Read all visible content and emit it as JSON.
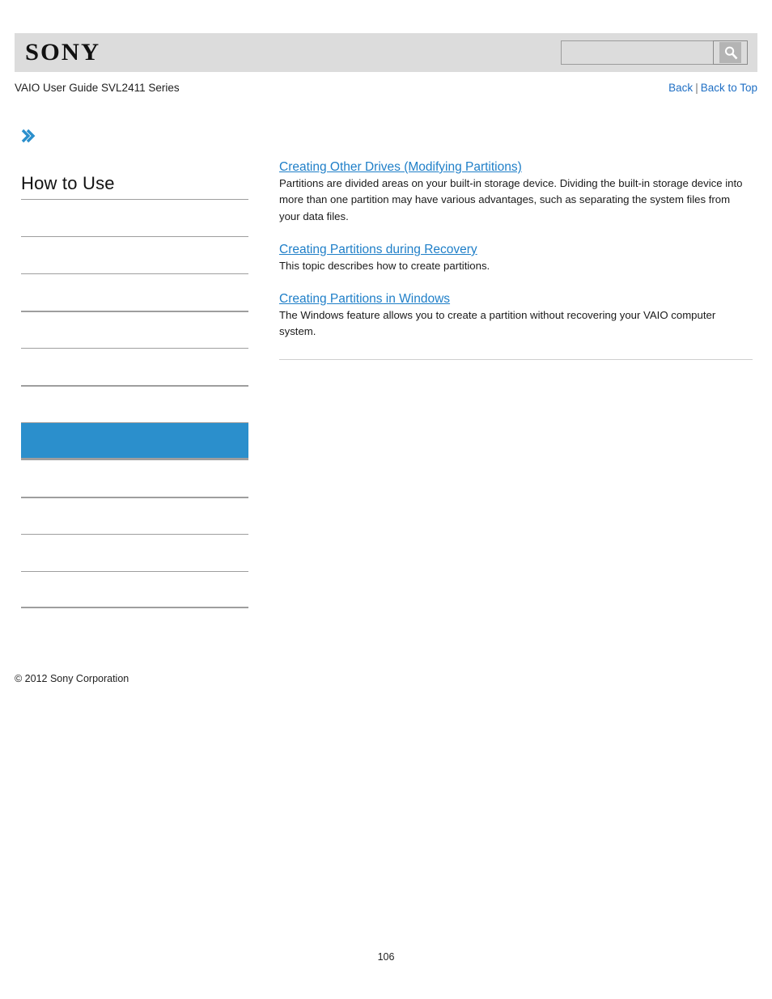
{
  "header": {
    "logo_text": "SONY",
    "logo_icon": "sony-wordmark",
    "search": {
      "value": "",
      "placeholder": "",
      "icon": "search-magnifier-icon"
    }
  },
  "subheader": {
    "guide_title": "VAIO User Guide SVL2411 Series",
    "links": {
      "back": "Back",
      "separator": "|",
      "back_to_top": "Back to Top"
    }
  },
  "sidebar": {
    "chevron_icon": "double-chevron-right-icon",
    "title": "How to Use",
    "items": [
      {
        "label": "",
        "active": false,
        "thick": false
      },
      {
        "label": "",
        "active": false,
        "thick": false
      },
      {
        "label": "",
        "active": false,
        "thick": false
      },
      {
        "label": "",
        "active": false,
        "thick": true
      },
      {
        "label": "",
        "active": false,
        "thick": false
      },
      {
        "label": "",
        "active": false,
        "thick": true
      },
      {
        "label": "",
        "active": true,
        "thick": false
      },
      {
        "label": "",
        "active": false,
        "thick": false
      },
      {
        "label": "",
        "active": false,
        "thick": true
      },
      {
        "label": "",
        "active": false,
        "thick": false
      },
      {
        "label": "",
        "active": false,
        "thick": false
      }
    ],
    "copyright": "© 2012 Sony Corporation"
  },
  "content": {
    "articles": [
      {
        "title": "Creating Other Drives (Modifying Partitions)",
        "description": "Partitions are divided areas on your built-in storage device. Dividing the built-in storage device into more than one partition may have various advantages, such as separating the system files from your data files."
      },
      {
        "title": "Creating Partitions during Recovery",
        "description": "This topic describes how to create partitions."
      },
      {
        "title": "Creating Partitions in Windows",
        "description": "The Windows feature allows you to create a partition without recovering your VAIO computer system."
      }
    ]
  },
  "footer": {
    "page_number": "106"
  },
  "colors": {
    "accent_blue": "#2b8fcc",
    "link_blue": "#1f6fc4",
    "title_blue": "#1f7fc8",
    "header_gray": "#dcdcdc",
    "rule_gray": "#9e9e9e"
  }
}
